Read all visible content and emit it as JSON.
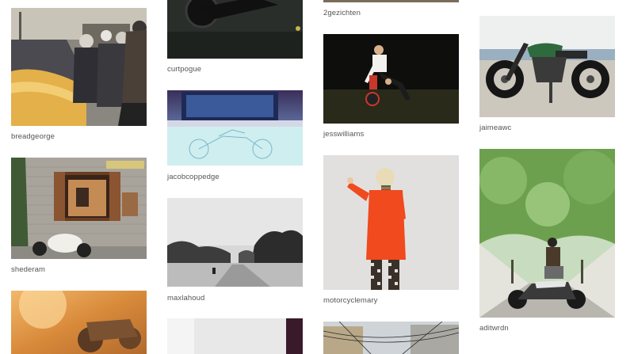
{
  "gallery": {
    "items": [
      {
        "username": "breadgeorge"
      },
      {
        "username": "shederam"
      },
      {
        "username": "curtpogue"
      },
      {
        "username": "jacobcoppedge"
      },
      {
        "username": "maxlahoud"
      },
      {
        "username": "2gezichten"
      },
      {
        "username": "jesswilliams"
      },
      {
        "username": "motorcyclemary"
      },
      {
        "username": "jaimeawc"
      },
      {
        "username": "aditwrdn"
      }
    ]
  }
}
